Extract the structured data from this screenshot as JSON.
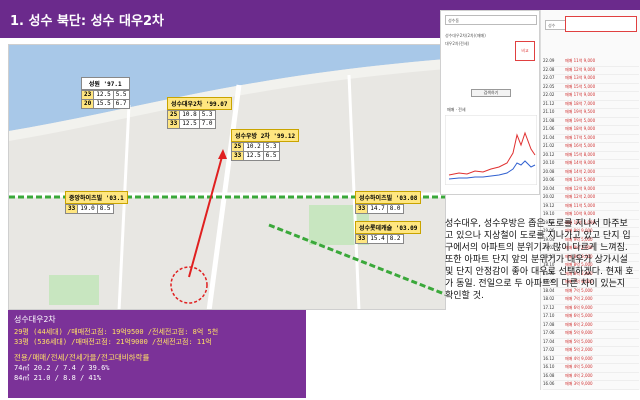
{
  "header": {
    "title": "1. 성수 북단: 성수 대우2차"
  },
  "map": {
    "top_left_box": {
      "label": "성원 '97.1",
      "rows": [
        [
          "23",
          "12.5",
          "5.5"
        ],
        [
          "20",
          "15.5",
          "6.7"
        ]
      ]
    },
    "boxes": [
      {
        "id": "daewoo2",
        "label": "성수대우2차 '99.07",
        "rows": [
          [
            "25",
            "10.8",
            "5.3"
          ],
          [
            "33",
            "12.5",
            "7.0"
          ]
        ]
      },
      {
        "id": "woobang2",
        "label": "성수우방 2차 '99.12",
        "rows": [
          [
            "25",
            "10.2",
            "5.3"
          ],
          [
            "33",
            "12.5",
            "6.5"
          ]
        ]
      },
      {
        "id": "joongang",
        "label": "중앙하이츠빌 '03.1",
        "rows": [
          [
            "33",
            "19.0",
            "8.5"
          ]
        ]
      },
      {
        "id": "high",
        "label": "성수하이츠빌 '03.08",
        "rows": [
          [
            "33",
            "14.7",
            "8.0"
          ]
        ]
      },
      {
        "id": "lotte",
        "label": "성수롯데캐슬 '03.09",
        "rows": [
          [
            "33",
            "15.4",
            "8.2"
          ]
        ]
      }
    ]
  },
  "info": {
    "title": "성수대우2차",
    "lines": [
      "29평 (44세대) /매매전고점: 19억9500 /전세전고점: 8억 5천",
      "33평 (536세대) /매매전고점: 21억9000 /전세전고점: 11억"
    ],
    "sub_header": "전용/매매/전세/전세가율/전고대비하락률",
    "sub_lines": [
      "74㎡ 20.2 / 7.4 / 39.6%",
      "84㎡ 21.0 / 8.8 / 41%"
    ]
  },
  "panel": {
    "search_text": "성수동",
    "checks": [
      "성수대우2차(2차)(매매)",
      "대우2차(전세)"
    ],
    "red_button": "비교",
    "apply_button": "검색하기",
    "radio": "매매 · 전세"
  },
  "rightlist": {
    "search_text": "성수",
    "rows": [
      [
        "22.09",
        "매매 11억 9,000"
      ],
      [
        "22.08",
        "매매 12억 9,000"
      ],
      [
        "22.07",
        "매매 13억 9,000"
      ],
      [
        "22.05",
        "매매 15억 5,000"
      ],
      [
        "22.02",
        "매매 17억 9,000"
      ],
      [
        "21.12",
        "매매 18억 7,000"
      ],
      [
        "21.10",
        "매매 19억 9,500"
      ],
      [
        "21.08",
        "매매 19억 5,000"
      ],
      [
        "21.06",
        "매매 18억 9,000"
      ],
      [
        "21.04",
        "매매 17억 5,000"
      ],
      [
        "21.02",
        "매매 16억 5,000"
      ],
      [
        "20.12",
        "매매 15억 8,000"
      ],
      [
        "20.10",
        "매매 14억 9,000"
      ],
      [
        "20.08",
        "매매 14억 2,000"
      ],
      [
        "20.06",
        "매매 13억 5,000"
      ],
      [
        "20.04",
        "매매 12억 9,000"
      ],
      [
        "20.02",
        "매매 12억 2,000"
      ],
      [
        "19.12",
        "매매 11억 5,000"
      ],
      [
        "19.10",
        "매매 10억 9,000"
      ],
      [
        "19.08",
        "매매 10억 5,000"
      ],
      [
        "19.06",
        "매매 9억 9,000"
      ],
      [
        "19.04",
        "매매 9억 5,000"
      ],
      [
        "19.02",
        "매매 9억 2,000"
      ],
      [
        "18.12",
        "매매 8억 9,000"
      ],
      [
        "18.10",
        "매매 8억 5,000"
      ],
      [
        "18.08",
        "매매 8억 2,000"
      ],
      [
        "18.06",
        "매매 7억 9,000"
      ],
      [
        "18.04",
        "매매 7억 5,000"
      ],
      [
        "18.02",
        "매매 7억 2,000"
      ],
      [
        "17.12",
        "매매 6억 9,000"
      ],
      [
        "17.10",
        "매매 6억 5,000"
      ],
      [
        "17.08",
        "매매 6억 2,000"
      ],
      [
        "17.06",
        "매매 5억 9,000"
      ],
      [
        "17.04",
        "매매 5억 5,000"
      ],
      [
        "17.02",
        "매매 5억 2,000"
      ],
      [
        "16.12",
        "매매 4억 9,000"
      ],
      [
        "16.10",
        "매매 4억 5,000"
      ],
      [
        "16.08",
        "매매 4억 2,000"
      ],
      [
        "16.06",
        "매매 3억 9,000"
      ]
    ]
  },
  "description": "성수대우, 성수우방은 좁은 도로를 지나서 마주보고 있으나 지상철이 도로를 지나가고 있고 단지 입구에서의 아파트의 분위기가 많이 다르게 느껴짐. 또한 아파트 단지 앞의 분위기가 대우가 상가시설 및 단지 안정감이 좋아 대우로 선택하겠다. 현재 호가 동일. 전일으로 두 아파트의 다른 차이 있는지 확인할 것."
}
